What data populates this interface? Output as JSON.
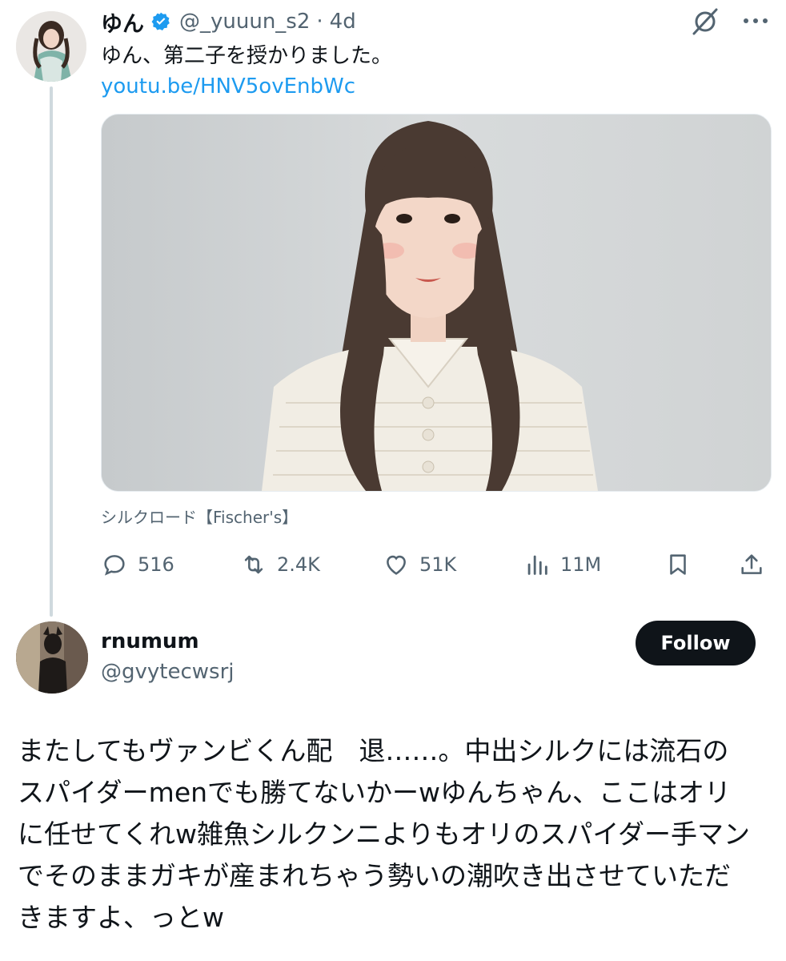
{
  "tweet": {
    "display_name": "ゆん",
    "handle": "@_yuuun_s2",
    "separator": "·",
    "time": "4d",
    "text": "ゆん、第二子を授かりました。",
    "link": "youtu.be/HNV5ovEnbWc",
    "media_caption": "シルクロード【Fischer's】",
    "stats": {
      "replies": "516",
      "retweets": "2.4K",
      "likes": "51K",
      "views": "11M"
    }
  },
  "reply": {
    "display_name": "rnumum",
    "handle": "@gvytecwsrj",
    "follow_label": "Follow",
    "text": "またしてもヴァンビくん配　退……。中出シルクには流石のスパイダーmenでも勝てないかーwゆんちゃん、ここはオリに任せてくれw雑魚シルクンニよりもオリのスパイダー手マンでそのままガキが産まれちゃう勢いの潮吹き出させていただきますよ、っとw"
  },
  "colors": {
    "accent": "#1d9bf0",
    "secondary_text": "#536471",
    "primary_text": "#0f1419",
    "follow_bg": "#0f1419"
  },
  "icons": [
    "verified-badge-icon",
    "grok-icon",
    "more-icon",
    "reply-icon",
    "retweet-icon",
    "like-icon",
    "views-icon",
    "bookmark-icon",
    "share-icon"
  ]
}
